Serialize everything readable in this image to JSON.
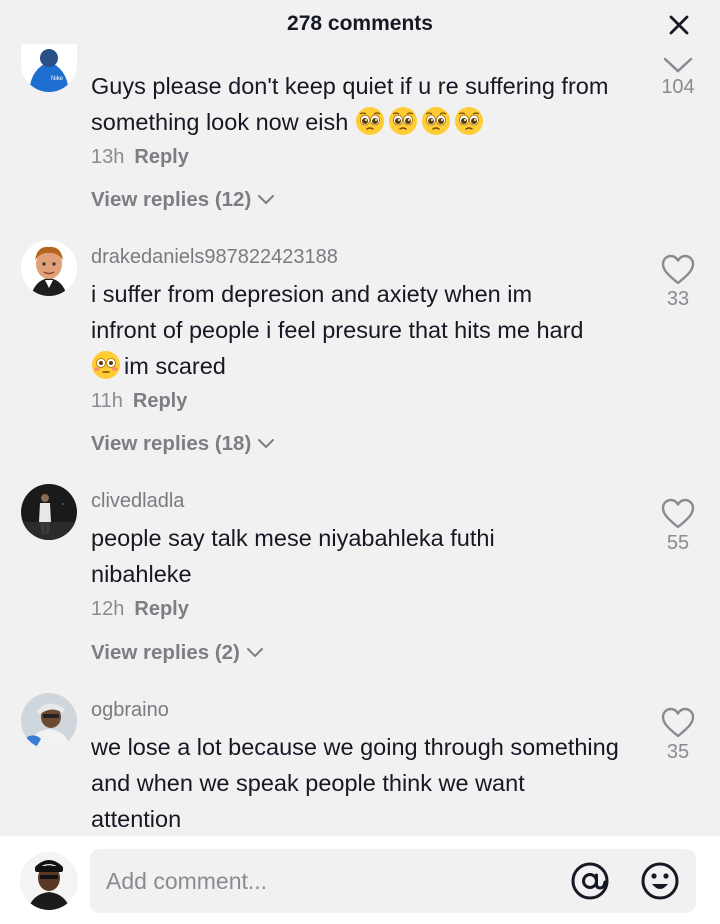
{
  "header": {
    "title": "278 comments"
  },
  "comments": [
    {
      "username": "",
      "text": "Guys please don't keep quiet if u re suffering from something look now eish",
      "emoji_after": [
        "pleading-face-emoji",
        "pleading-face-emoji",
        "pleading-face-emoji",
        "pleading-face-emoji"
      ],
      "time": "13h",
      "reply": "Reply",
      "view_replies": "View replies (12)",
      "likes": "104"
    },
    {
      "username": "drakedaniels987822423188",
      "text_before": "i suffer from depresion and axiety when im infront of people i feel presure that hits me hard ",
      "emoji": "flushed-face-emoji",
      "text_after": "im scared",
      "time": "11h",
      "reply": "Reply",
      "view_replies": "View replies (18)",
      "likes": "33"
    },
    {
      "username": "clivedladla",
      "text": "people say talk mese niyabahleka futhi nibahleke",
      "time": "12h",
      "reply": "Reply",
      "view_replies": "View replies (2)",
      "likes": "55"
    },
    {
      "username": "ogbraino",
      "text": "we lose a lot because we going through something and when we speak people think we want attention",
      "likes": "35"
    }
  ],
  "footer": {
    "placeholder": "Add comment..."
  },
  "colors": {
    "background": "#f1f1f2",
    "text": "#161823",
    "secondary": "#8a8b91"
  }
}
